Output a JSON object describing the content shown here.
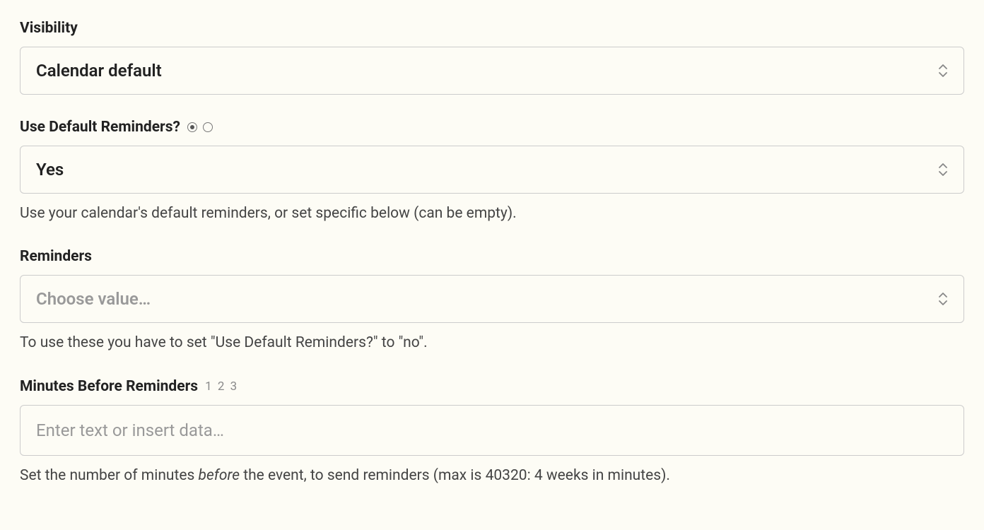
{
  "visibility": {
    "label": "Visibility",
    "value": "Calendar default"
  },
  "use_default_reminders": {
    "label": "Use Default Reminders?",
    "value": "Yes",
    "help": "Use your calendar's default reminders, or set specific below (can be empty)."
  },
  "reminders": {
    "label": "Reminders",
    "placeholder": "Choose value…",
    "help": "To use these you have to set \"Use Default Reminders?\" to \"no\"."
  },
  "minutes_before": {
    "label": "Minutes Before Reminders",
    "suffix": "1 2 3",
    "placeholder": "Enter text or insert data…",
    "help_pre": "Set the number of minutes ",
    "help_em": "before",
    "help_post": " the event, to send reminders (max is 40320: 4 weeks in minutes)."
  }
}
